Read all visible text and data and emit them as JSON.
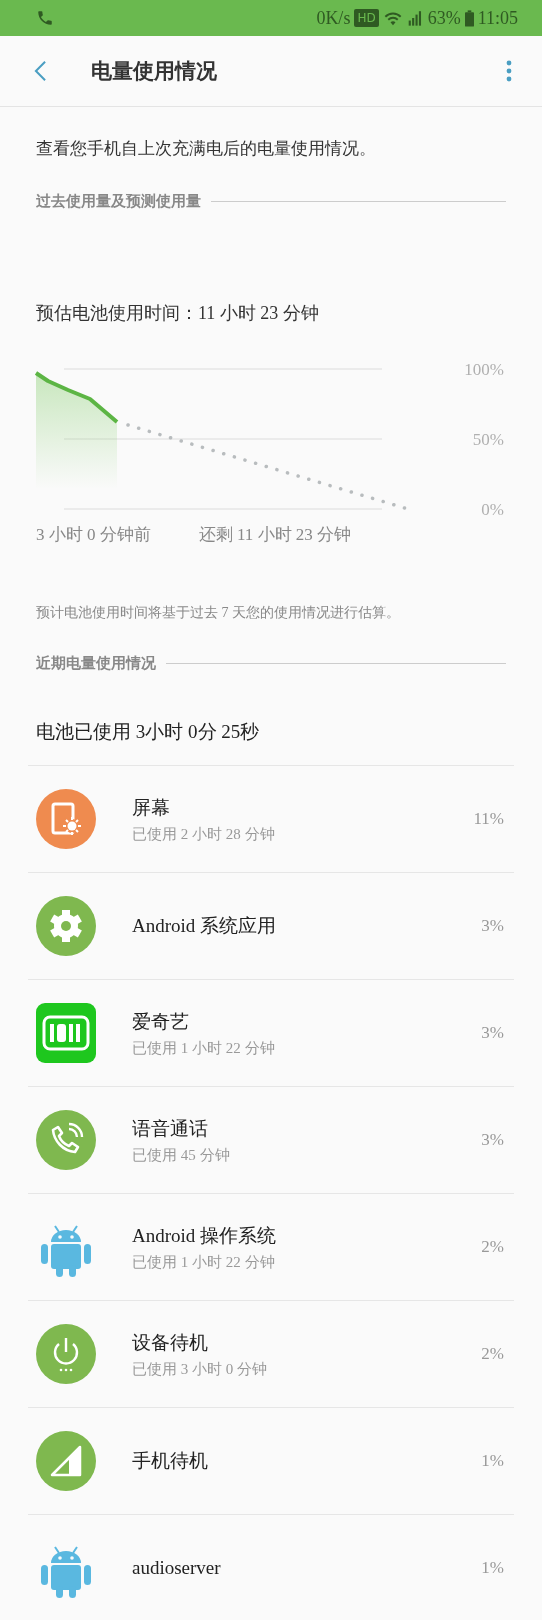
{
  "status_bar": {
    "speed": "0K/s",
    "hd": "HD",
    "battery": "63%",
    "time": "11:05"
  },
  "header": {
    "title": "电量使用情况"
  },
  "description": "查看您手机自上次充满电后的电量使用情况。",
  "section_1": {
    "title": "过去使用量及预测使用量"
  },
  "estimate": "预估电池使用时间：11 小时 23 分钟",
  "chart": {
    "y_labels": [
      "100%",
      "50%",
      "0%"
    ],
    "start_label": "3 小时 0 分钟前",
    "end_label": "还剩 11 小时 23 分钟"
  },
  "note": "预计电池使用时间将基于过去 7 天您的使用情况进行估算。",
  "section_2": {
    "title": "近期电量使用情况"
  },
  "battery_used": "电池已使用 3小时 0分 25秒",
  "apps": [
    {
      "name": "屏幕",
      "usage": "已使用 2 小时 28 分钟",
      "percent": "11%"
    },
    {
      "name": "Android 系统应用",
      "percent": "3%"
    },
    {
      "name": "爱奇艺",
      "usage": "已使用 1 小时 22 分钟",
      "percent": "3%"
    },
    {
      "name": "语音通话",
      "usage": "已使用 45 分钟",
      "percent": "3%"
    },
    {
      "name": "Android 操作系统",
      "usage": "已使用 1 小时 22 分钟",
      "percent": "2%"
    },
    {
      "name": "设备待机",
      "usage": "已使用 3 小时 0 分钟",
      "percent": "2%"
    },
    {
      "name": "手机待机",
      "percent": "1%"
    },
    {
      "name": "audioserver",
      "percent": "1%"
    }
  ]
}
